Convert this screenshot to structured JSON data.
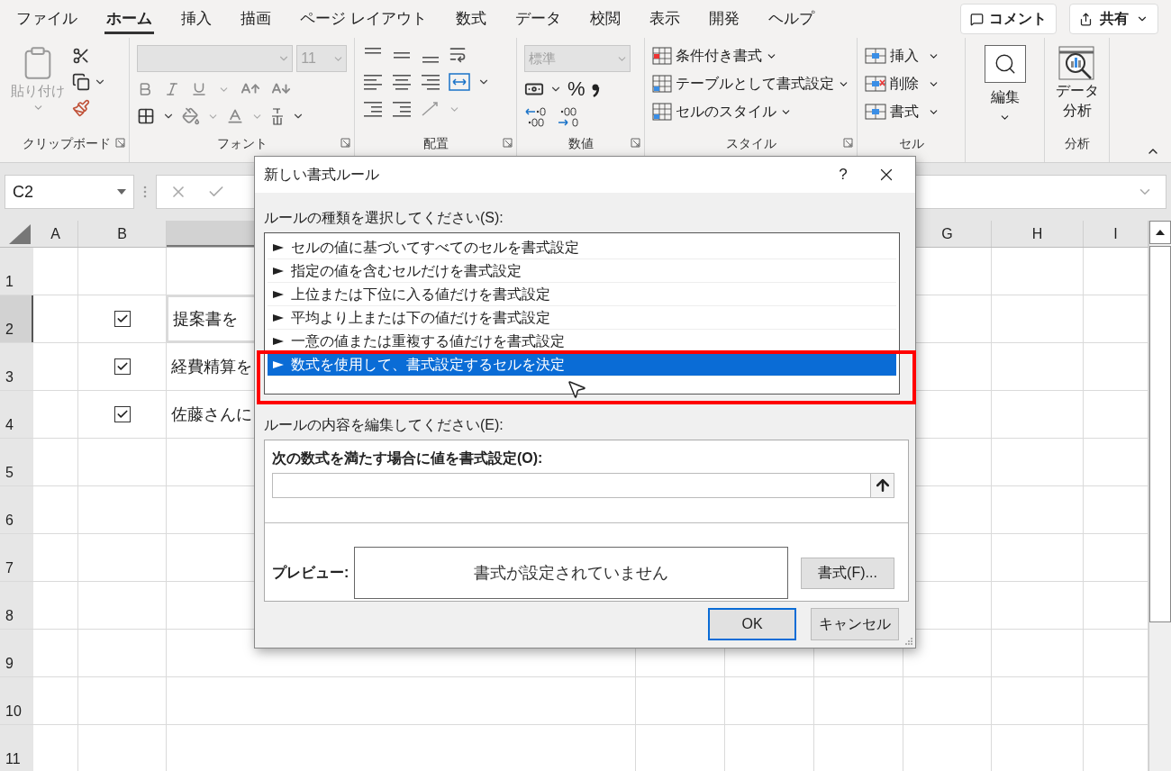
{
  "ribbon_tabs": [
    {
      "label": "ファイル",
      "selected": false
    },
    {
      "label": "ホーム",
      "selected": true
    },
    {
      "label": "挿入",
      "selected": false
    },
    {
      "label": "描画",
      "selected": false
    },
    {
      "label": "ページ レイアウト",
      "selected": false
    },
    {
      "label": "数式",
      "selected": false
    },
    {
      "label": "データ",
      "selected": false
    },
    {
      "label": "校閲",
      "selected": false
    },
    {
      "label": "表示",
      "selected": false
    },
    {
      "label": "開発",
      "selected": false
    },
    {
      "label": "ヘルプ",
      "selected": false
    }
  ],
  "header_buttons": {
    "comment": "コメント",
    "share": "共有"
  },
  "ribbon": {
    "clipboard": {
      "paste": {
        "label": "貼り付け",
        "disabled": true
      },
      "group_label": "クリップボード"
    },
    "font": {
      "size": "11",
      "group_label": "フォント"
    },
    "alignment": {
      "group_label": "配置"
    },
    "number": {
      "format": "標準",
      "percent": "%",
      "group_label": "数値"
    },
    "styles": {
      "items": [
        "条件付き書式",
        "テーブルとして書式設定",
        "セルのスタイル"
      ],
      "group_label": "スタイル"
    },
    "cells": {
      "items": [
        "挿入",
        "削除",
        "書式"
      ],
      "group_label": "セル"
    },
    "editing": {
      "label": "編集"
    },
    "analysis": {
      "label_lines": [
        "データ",
        "分析"
      ],
      "group_label": "分析"
    }
  },
  "formula_bar": {
    "name_box": "C2"
  },
  "sheet": {
    "columns": [
      {
        "label": "A",
        "selected": false
      },
      {
        "label": "B",
        "selected": false
      },
      {
        "selected": true
      },
      {
        "label": "G",
        "selected": false
      },
      {
        "label": "H",
        "selected": false
      },
      {
        "label": "I",
        "selected": false
      }
    ],
    "rows": [
      {
        "label": "1",
        "selected": false
      },
      {
        "label": "2",
        "selected": true
      },
      {
        "label": "3",
        "selected": false
      },
      {
        "label": "4",
        "selected": false
      },
      {
        "label": "5",
        "selected": false
      },
      {
        "label": "6",
        "selected": false
      },
      {
        "label": "7",
        "selected": false
      },
      {
        "label": "8",
        "selected": false
      },
      {
        "label": "9",
        "selected": false
      },
      {
        "label": "10",
        "selected": false
      },
      {
        "label": "11",
        "selected": false
      }
    ],
    "tasks": [
      {
        "checked": true,
        "text": "提案書を"
      },
      {
        "checked": true,
        "text": "経費精算を"
      },
      {
        "checked": true,
        "text": "佐藤さんに"
      }
    ]
  },
  "dialog": {
    "title": "新しい書式ルール",
    "help": "?",
    "rule_type_label": "ルールの種類を選択してください(S):",
    "rule_types": [
      {
        "label": "セルの値に基づいてすべてのセルを書式設定",
        "selected": false
      },
      {
        "label": "指定の値を含むセルだけを書式設定",
        "selected": false
      },
      {
        "label": "上位または下位に入る値だけを書式設定",
        "selected": false
      },
      {
        "label": "平均より上または下の値だけを書式設定",
        "selected": false
      },
      {
        "label": "一意の値または重複する値だけを書式設定",
        "selected": false
      },
      {
        "label": "数式を使用して、書式設定するセルを決定",
        "selected": true
      }
    ],
    "edit_label": "ルールの内容を編集してください(E):",
    "formula_label": "次の数式を満たす場合に値を書式設定(O):",
    "preview_label": "プレビュー:",
    "preview_text": "書式が設定されていません",
    "buttons": {
      "format": "書式(F)...",
      "ok": "OK",
      "cancel": "キャンセル"
    }
  }
}
